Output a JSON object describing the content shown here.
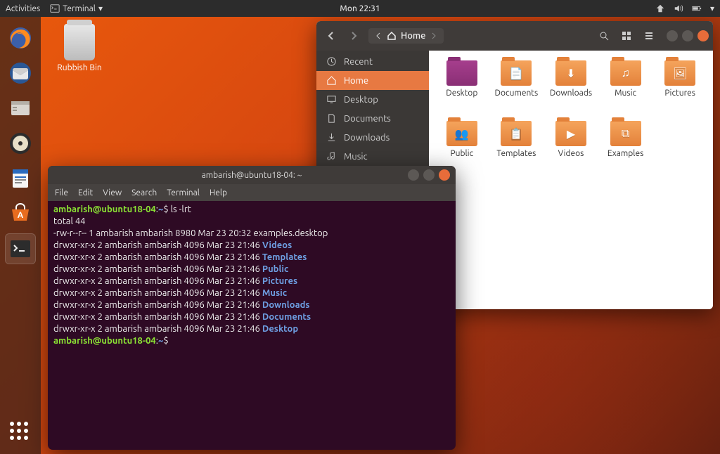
{
  "topbar": {
    "activities": "Activities",
    "app_label": "Terminal",
    "clock": "Mon 22:31"
  },
  "desktop": {
    "trash_label": "Rubbish Bin"
  },
  "dock": {
    "items": [
      "firefox",
      "thunderbird",
      "files",
      "rhythmbox",
      "libreoffice",
      "software",
      "terminal"
    ]
  },
  "files": {
    "path_label": "Home",
    "sidebar": [
      {
        "icon": "clock",
        "label": "Recent"
      },
      {
        "icon": "home",
        "label": "Home",
        "active": true
      },
      {
        "icon": "desktop",
        "label": "Desktop"
      },
      {
        "icon": "doc",
        "label": "Documents"
      },
      {
        "icon": "download",
        "label": "Downloads"
      },
      {
        "icon": "music",
        "label": "Music"
      }
    ],
    "folders": [
      {
        "label": "Desktop",
        "variant": "desktop-f"
      },
      {
        "label": "Documents"
      },
      {
        "label": "Downloads"
      },
      {
        "label": "Music"
      },
      {
        "label": "Pictures"
      },
      {
        "label": "Public"
      },
      {
        "label": "Templates"
      },
      {
        "label": "Videos"
      },
      {
        "label": "Examples"
      }
    ]
  },
  "terminal": {
    "title": "ambarish@ubuntu18-04: ~",
    "menu": [
      "File",
      "Edit",
      "View",
      "Search",
      "Terminal",
      "Help"
    ],
    "prompt_user": "ambarish@ubuntu18-04",
    "prompt_path": "~",
    "command": "ls -lrt",
    "output_header": "total 44",
    "rows": [
      {
        "perm": "-rw-r--r-- 1 ambarish ambarish 8980 Mar 23 20:32 ",
        "name": "examples.desktop",
        "dir": false
      },
      {
        "perm": "drwxr-xr-x 2 ambarish ambarish 4096 Mar 23 21:46 ",
        "name": "Videos",
        "dir": true
      },
      {
        "perm": "drwxr-xr-x 2 ambarish ambarish 4096 Mar 23 21:46 ",
        "name": "Templates",
        "dir": true
      },
      {
        "perm": "drwxr-xr-x 2 ambarish ambarish 4096 Mar 23 21:46 ",
        "name": "Public",
        "dir": true
      },
      {
        "perm": "drwxr-xr-x 2 ambarish ambarish 4096 Mar 23 21:46 ",
        "name": "Pictures",
        "dir": true
      },
      {
        "perm": "drwxr-xr-x 2 ambarish ambarish 4096 Mar 23 21:46 ",
        "name": "Music",
        "dir": true
      },
      {
        "perm": "drwxr-xr-x 2 ambarish ambarish 4096 Mar 23 21:46 ",
        "name": "Downloads",
        "dir": true
      },
      {
        "perm": "drwxr-xr-x 2 ambarish ambarish 4096 Mar 23 21:46 ",
        "name": "Documents",
        "dir": true
      },
      {
        "perm": "drwxr-xr-x 2 ambarish ambarish 4096 Mar 23 21:46 ",
        "name": "Desktop",
        "dir": true
      }
    ]
  }
}
